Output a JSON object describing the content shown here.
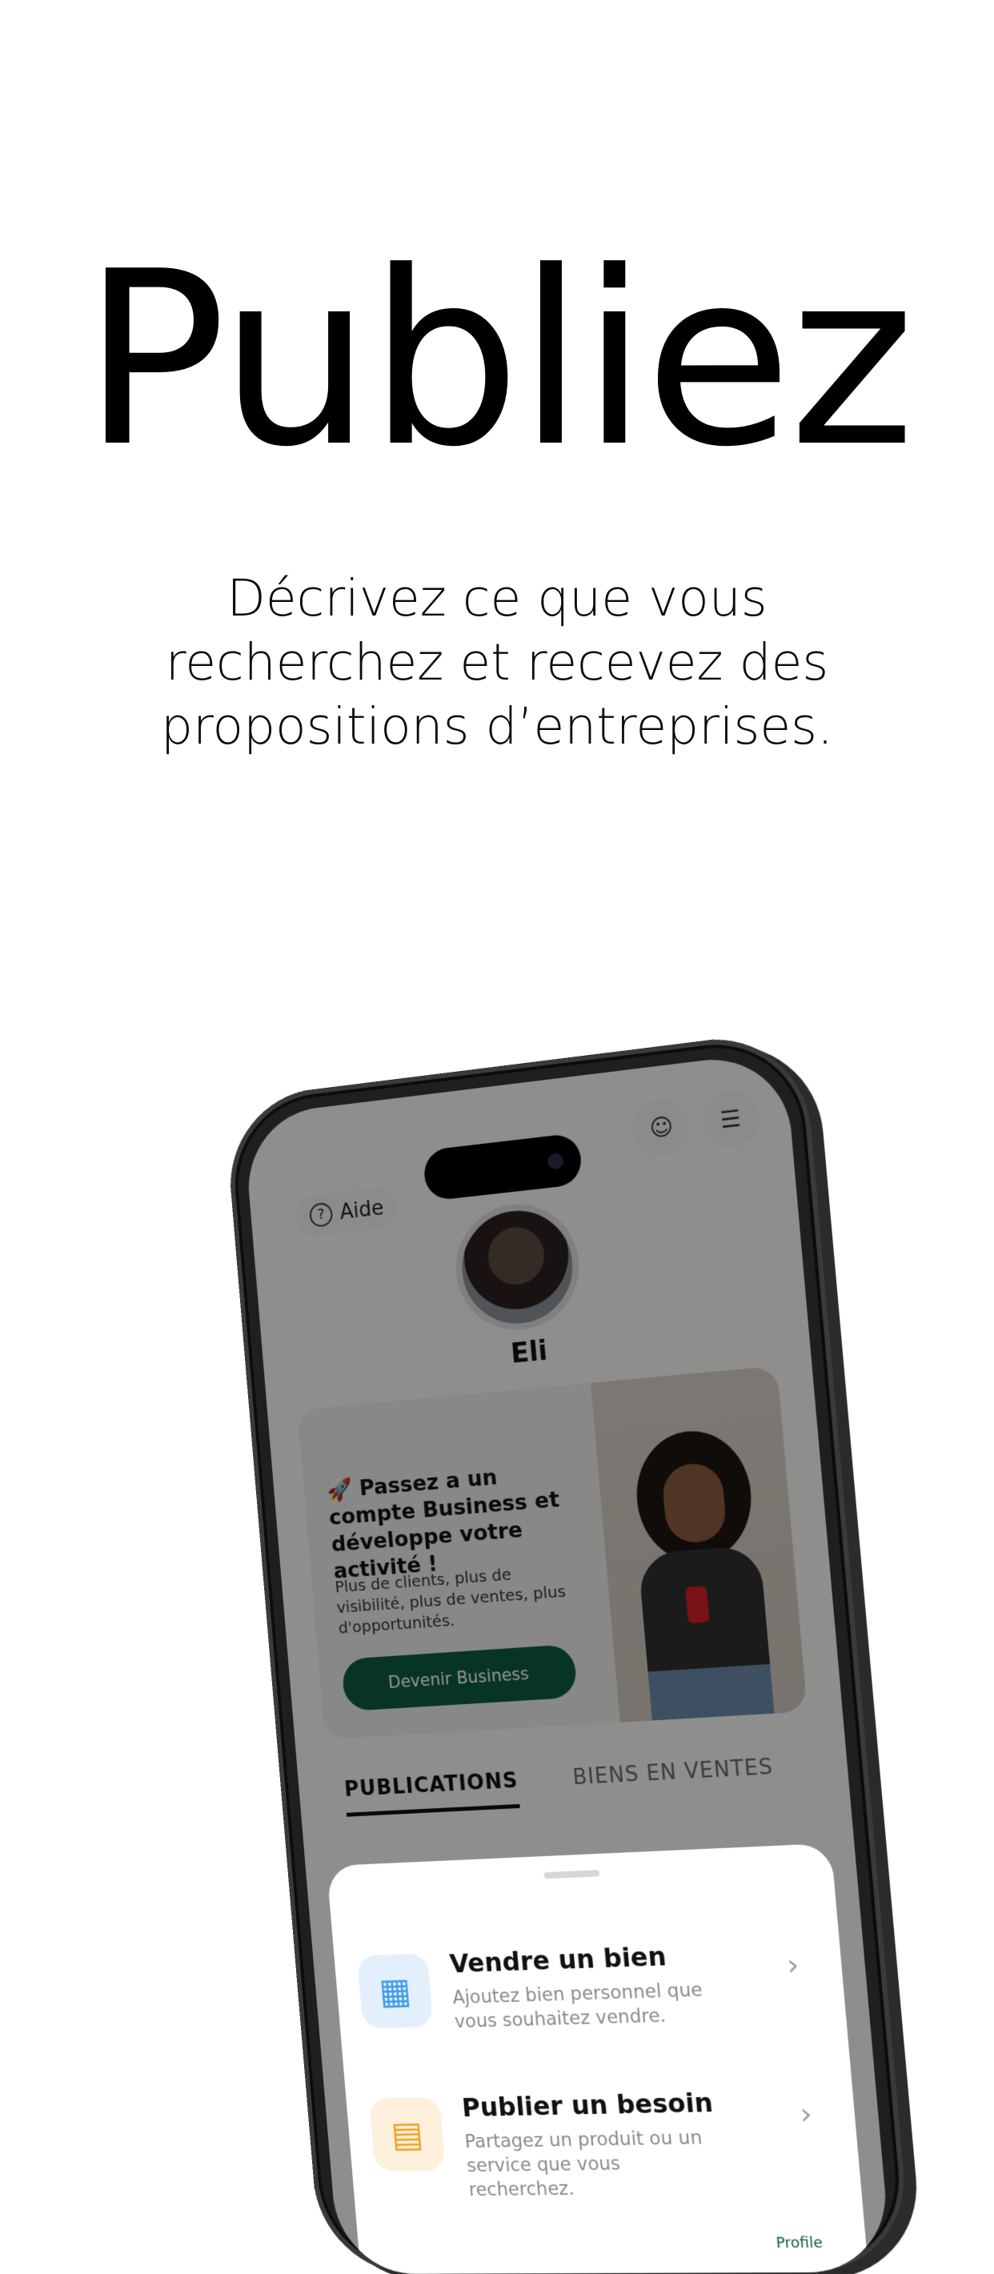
{
  "hero": {
    "title": "Publiez",
    "subtitle": "Décrivez ce que vous\nrecherchez et recevez des\npropositions d’entreprises."
  },
  "app": {
    "help_label": "Aide",
    "user_name": "Eli",
    "promo": {
      "title": "🚀 Passez a un compte Business et développe votre activité !",
      "text": "Plus de clients, plus de visibilité, plus de ventes, plus d'opportunités.",
      "button_label": "Devenir Business"
    },
    "tabs": [
      {
        "label": "PUBLICATIONS",
        "active": true
      },
      {
        "label": "BIENS EN VENTES",
        "active": false
      }
    ],
    "sheet": {
      "items": [
        {
          "title": "Vendre un bien",
          "description": "Ajoutez bien personnel que vous souhaitez vendre.",
          "icon": "cube-icon",
          "icon_color": "#3b9ae8",
          "icon_bg": "#e3f0fb"
        },
        {
          "title": "Publier un besoin",
          "description": "Partagez un produit ou un service que vous recherchez.",
          "icon": "document-icon",
          "icon_color": "#f0a020",
          "icon_bg": "#fdf0dc"
        }
      ]
    },
    "nav_profile_label": "Profile"
  },
  "colors": {
    "brand_green": "#0f5a44",
    "background": "#ffffff"
  }
}
